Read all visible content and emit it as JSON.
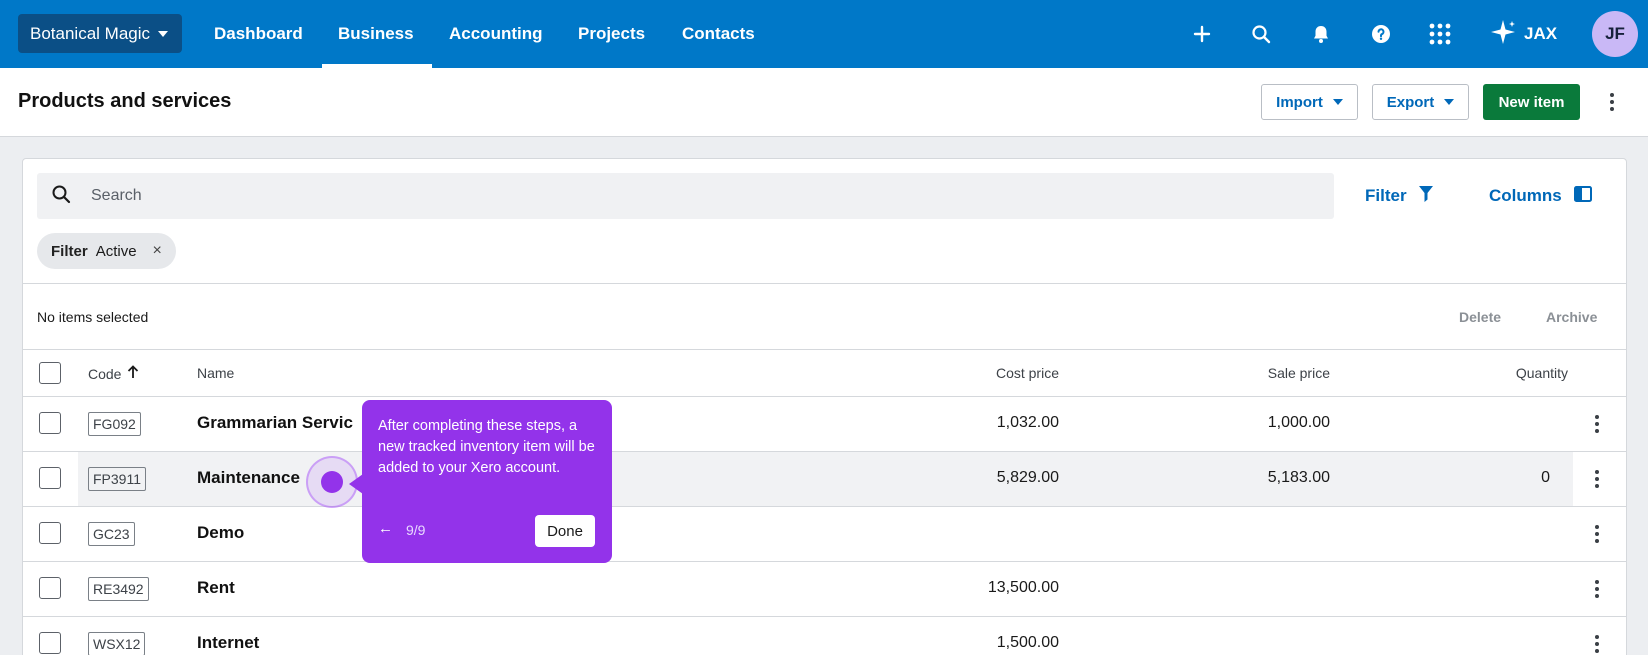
{
  "topnav": {
    "org_name": "Botanical Magic",
    "links": [
      "Dashboard",
      "Business",
      "Accounting",
      "Projects",
      "Contacts"
    ],
    "active_link": "Business",
    "assistant_label": "JAX",
    "avatar_initials": "JF",
    "icons": [
      "plus-icon",
      "search-icon",
      "bell-icon",
      "help-icon",
      "apps-grid-icon",
      "sparkle-icon"
    ]
  },
  "header": {
    "title": "Products and services",
    "import_label": "Import",
    "export_label": "Export",
    "new_item_label": "New item"
  },
  "toolbar": {
    "search_placeholder": "Search",
    "filter_label": "Filter",
    "columns_label": "Columns"
  },
  "filter_chip": {
    "key": "Filter",
    "value": "Active",
    "remove": "×"
  },
  "bulk": {
    "selection_text": "No items selected",
    "delete_label": "Delete",
    "archive_label": "Archive"
  },
  "table": {
    "columns": [
      "Code",
      "Name",
      "Cost price",
      "Sale price",
      "Quantity"
    ],
    "sort_column": "Code",
    "sort_direction": "ascending",
    "rows": [
      {
        "code": "FG092",
        "name": "Grammarian Servic",
        "cost": "1,032.00",
        "sale": "1,000.00",
        "qty": ""
      },
      {
        "code": "FP3911",
        "name": "Maintenance",
        "cost": "5,829.00",
        "sale": "5,183.00",
        "qty": "0"
      },
      {
        "code": "GC23",
        "name": "Demo",
        "cost": "",
        "sale": "",
        "qty": ""
      },
      {
        "code": "RE3492",
        "name": "Rent",
        "cost": "13,500.00",
        "sale": "",
        "qty": ""
      },
      {
        "code": "WSX12",
        "name": "Internet",
        "cost": "1,500.00",
        "sale": "",
        "qty": ""
      }
    ]
  },
  "tooltip": {
    "text": "After completing these steps, a new tracked inventory item will be added to your Xero account.",
    "back": "←",
    "step": "9/9",
    "done_label": "Done"
  },
  "colors": {
    "nav_bg": "#0078c8",
    "org_btn_bg": "#0b4f86",
    "link_blue": "#0068b8",
    "new_item_green": "#0a7a3b",
    "tooltip_purple": "#9333ea",
    "avatar_bg": "#c9b8f6"
  }
}
